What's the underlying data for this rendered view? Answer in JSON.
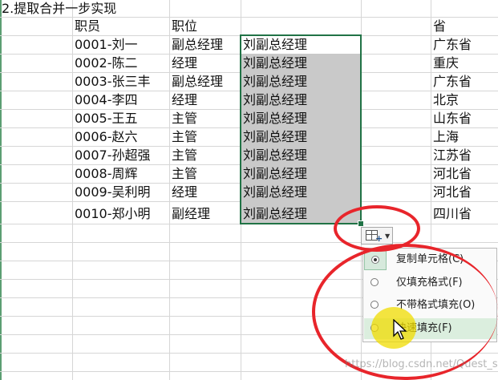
{
  "title": "2.提取合并一步实现",
  "headers": {
    "employee": "职员",
    "position": "职位",
    "province": "省"
  },
  "rows": [
    {
      "employee": "0001-刘一",
      "position": "副总经理",
      "fill": "刘副总经理",
      "province": "广东省"
    },
    {
      "employee": "0002-陈二",
      "position": "经理",
      "fill": "刘副总经理",
      "province": "重庆"
    },
    {
      "employee": "0003-张三丰",
      "position": "副总经理",
      "fill": "刘副总经理",
      "province": "广东省"
    },
    {
      "employee": "0004-李四",
      "position": "经理",
      "fill": "刘副总经理",
      "province": "北京"
    },
    {
      "employee": "0005-王五",
      "position": "主管",
      "fill": "刘副总经理",
      "province": "山东省"
    },
    {
      "employee": "0006-赵六",
      "position": "主管",
      "fill": "刘副总经理",
      "province": "上海"
    },
    {
      "employee": "0007-孙超强",
      "position": "主管",
      "fill": "刘副总经理",
      "province": "江苏省"
    },
    {
      "employee": "0008-周辉",
      "position": "主管",
      "fill": "刘副总经理",
      "province": "河北省"
    },
    {
      "employee": "0009-吴利明",
      "position": "经理",
      "fill": "刘副总经理",
      "province": "河北省"
    },
    {
      "employee": "0010-郑小明",
      "position": "副经理",
      "fill": "刘副总经理",
      "province": "四川省"
    }
  ],
  "autofill_menu": {
    "icon": "autofill-options-icon",
    "items": [
      {
        "label": "复制单元格(C)",
        "selected": true
      },
      {
        "label": "仅填充格式(F)",
        "selected": false
      },
      {
        "label": "不带格式填充(O)",
        "selected": false
      },
      {
        "label": "快速填充(F)",
        "selected": false,
        "hover": true
      }
    ]
  },
  "watermark": "https://blog.csdn.net/Quest_sac",
  "colors": {
    "selection_border": "#217346",
    "annotation": "#e8252b",
    "highlight": "#f0dc00"
  }
}
